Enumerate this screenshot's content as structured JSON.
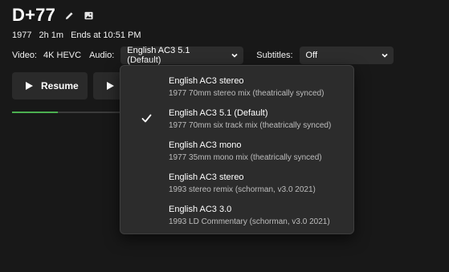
{
  "title": "D+77",
  "meta": {
    "year": "1977",
    "runtime": "2h 1m",
    "ends": "Ends at 10:51 PM"
  },
  "media": {
    "video_label": "Video:",
    "video_value": "4K HEVC",
    "audio_label": "Audio:",
    "audio_value": "English AC3 5.1 (Default)",
    "subtitles_label": "Subtitles:",
    "subtitles_value": "Off"
  },
  "actions": {
    "resume_label": "Resume"
  },
  "progress": {
    "fraction": 0.42
  },
  "audio_options": [
    {
      "name": "English AC3 stereo",
      "desc": "1977 70mm stereo mix (theatrically synced)",
      "selected": false
    },
    {
      "name": "English AC3 5.1 (Default)",
      "desc": "1977 70mm six track mix (theatrically synced)",
      "selected": true
    },
    {
      "name": "English AC3 mono",
      "desc": "1977 35mm mono mix (theatrically synced)",
      "selected": false
    },
    {
      "name": "English AC3 stereo",
      "desc": "1993 stereo remix (schorman, v3.0 2021)",
      "selected": false
    },
    {
      "name": "English AC3 3.0",
      "desc": "1993 LD Commentary (schorman, v3.0 2021)",
      "selected": false
    }
  ],
  "colors": {
    "accent": "#4caf50",
    "background": "#181818",
    "menu": "#2c2c2c"
  },
  "icons": {
    "edit": "pencil-icon",
    "image": "image-icon",
    "play": "play-icon",
    "chevron": "chevron-down-icon",
    "check": "checkmark-icon"
  }
}
